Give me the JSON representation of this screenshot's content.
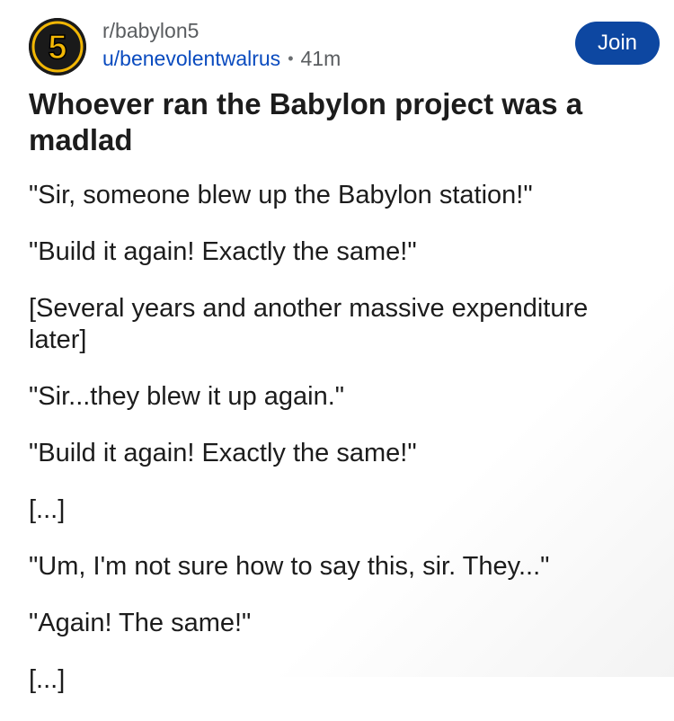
{
  "header": {
    "subreddit": "r/babylon5",
    "username": "u/benevolentwalrus",
    "separator": "•",
    "time_ago": "41m",
    "join_label": "Join",
    "avatar_icon": "babylon5-logo-icon",
    "avatar_glyph": "5"
  },
  "post": {
    "title": "Whoever ran the Babylon project was a madlad",
    "paragraphs": [
      "\"Sir, someone blew up the Babylon station!\"",
      "\"Build it again! Exactly the same!\"",
      "[Several years and another massive expenditure later]",
      "\"Sir...they blew it up again.\"",
      "\"Build it again! Exactly the same!\"",
      "[...]",
      "\"Um, I'm not sure how to say this, sir. They...\"",
      "\"Again! The same!\"",
      "[...]"
    ]
  },
  "colors": {
    "join_bg": "#0d47a1",
    "username": "#0a4bbf",
    "avatar_bg": "#1a1a1a",
    "logo_gold": "#f2b705"
  }
}
